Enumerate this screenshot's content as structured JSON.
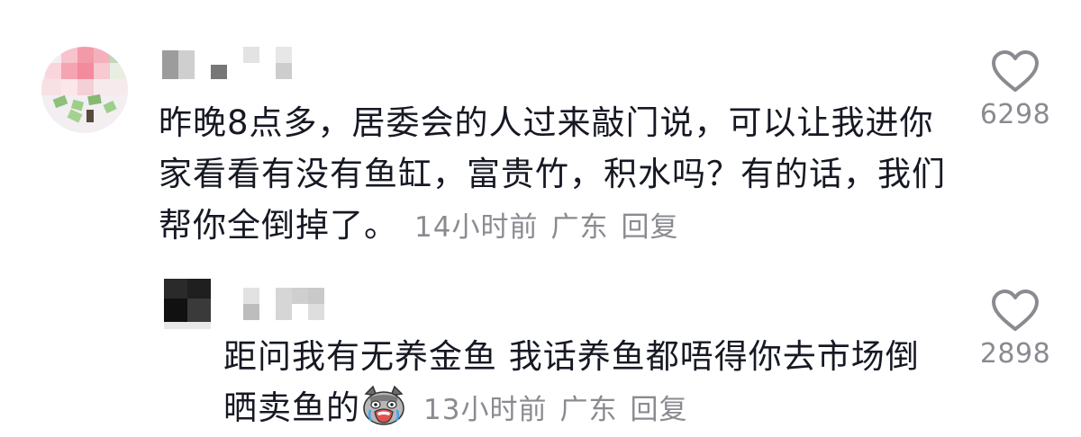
{
  "comments": [
    {
      "text": "昨晚8点多，居委会的人过来敲门说，可以让我进你家看看有没有鱼缸，富贵竹，积水吗？有的话，我们帮你全倒掉了。",
      "time": "14小时前",
      "location": "广东",
      "reply_label": "回复",
      "likes": "6298",
      "like_icon": "heart-outline-icon"
    },
    {
      "text": "距问我有无养金鱼 我话养鱼都唔得你去市场倒晒卖鱼的",
      "emoji": "crying-cat-emoji",
      "time": "13小时前",
      "location": "广东",
      "reply_label": "回复",
      "likes": "2898",
      "like_icon": "heart-outline-icon"
    }
  ],
  "colors": {
    "text": "#161823",
    "meta": "#8a8b91"
  }
}
